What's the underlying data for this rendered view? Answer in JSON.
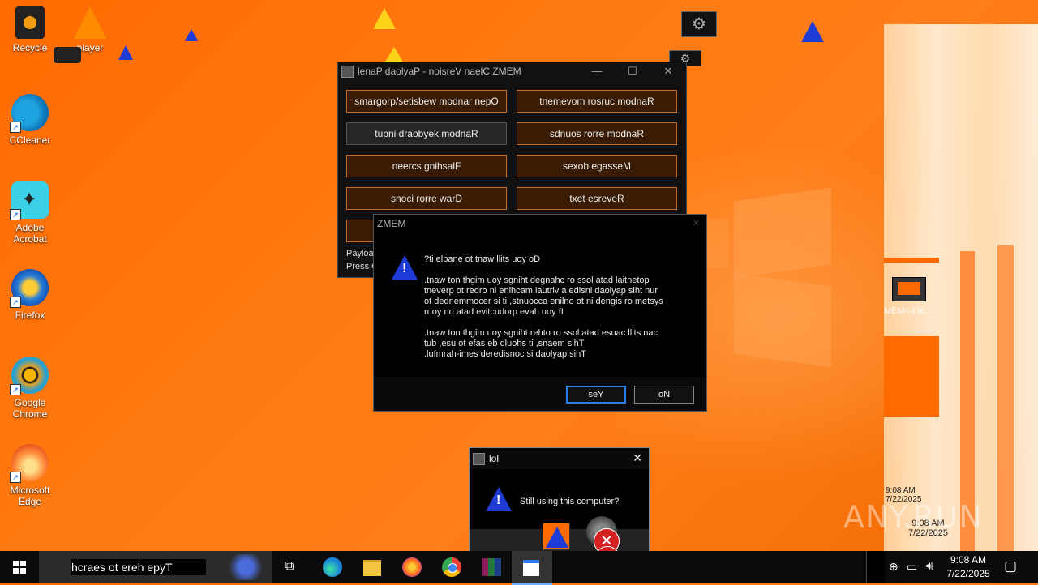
{
  "desktop": {
    "icons": [
      {
        "label": "Recycle",
        "icon": "recycle-bin-icon"
      },
      {
        "label": "player",
        "icon": "vlc-player-icon"
      },
      {
        "label": "CCleaner",
        "icon": "ccleaner-icon"
      },
      {
        "label": "Adobe Acrobat",
        "icon": "acrobat-icon"
      },
      {
        "label": "Firefox",
        "icon": "firefox-icon"
      },
      {
        "label": "Google Chrome",
        "icon": "chrome-icon"
      },
      {
        "label": "Microsoft Edge",
        "icon": "edge-icon"
      }
    ]
  },
  "main_window": {
    "title": "lenaP daolyaP - noisreV naelC ZMEM",
    "buttons": [
      "smargorp/setisbew modnar nepO",
      "tnemevom rosruc modnaR",
      "tupni draobyek modnaR",
      "sdnuos rorre modnaR",
      "neercs gnihsalF",
      "sexob egasseM",
      "snoci rorre warD",
      "txet esreveR"
    ],
    "status_line1": "Payloa",
    "status_line2": "Press C"
  },
  "dialog": {
    "title": "ZMEM",
    "line_question": "?ti elbane ot tnaw llits uoy oD",
    "para1": ".tnaw ton thgim uoy sgniht degnahc ro ssol atad laitnetop\ntneverp ot redro ni enihcam lautriv a edisni daolyap siht nur\not dednemmocer si ti ,stnuocca enilno ot ni dengis ro metsys\nruoy no atad evitcudorp evah uoy fI",
    "para2": ".tnaw ton thgim uoy sgniht rehto ro ssol atad esuac llits nac\ntub ,esu ot efas eb dluohs ti ,snaem sihT\n.lufmrah-imes deredisnoc si daolyap sihT",
    "yes_label": "seY",
    "no_label": "oN"
  },
  "lol_dialog": {
    "title": "lol",
    "message": "Still using this computer?"
  },
  "taskbar": {
    "search_placeholder": "hcraes ot ereh epyT",
    "time": "9:08 AM",
    "date": "7/22/2025"
  },
  "right_artifacts": {
    "label_fragment": "MEM<-l le...",
    "time1": "9:08 AM",
    "date1": "7/22/2025",
    "time2": "9:08 AM",
    "date2": "7/22/2025"
  },
  "watermark": "ANY.RUN",
  "colors": {
    "desktop_orange": "#ff6a00",
    "accent_button_border": "#c86a1f",
    "default_button_border": "#2b7de9",
    "warning_blue": "#1f3bd6"
  }
}
